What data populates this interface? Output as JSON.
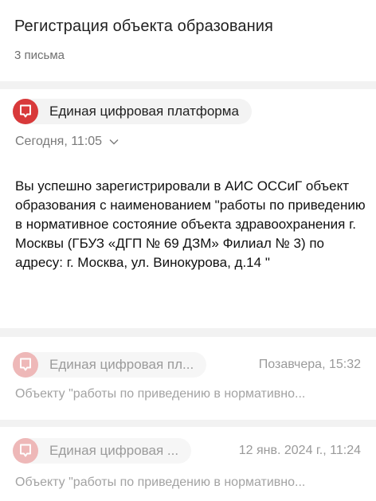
{
  "thread": {
    "title": "Регистрация объекта образования",
    "count": "3 письма"
  },
  "messages": [
    {
      "sender": "Единая цифровая платформа",
      "date": "Сегодня, 11:05",
      "body": "Вы успешно зарегистрировали в АИС ОССиГ объект образования с наименованием \"работы по приведению в нормативное состояние объекта здравоохранения г. Москвы (ГБУЗ «ДГП № 69 ДЗМ» Филиал № 3) по адресу: г. Москва, ул. Винокурова, д.14 \""
    },
    {
      "sender": "Единая цифровая пл...",
      "date": "Позавчера, 15:32",
      "preview": "Объекту \"работы по приведению в нормативно..."
    },
    {
      "sender": "Единая цифровая ...",
      "date": "12 янв. 2024 г., 11:24",
      "preview": "Объекту \"работы по приведению в нормативно..."
    }
  ],
  "colors": {
    "accent": "#d8393a",
    "accent_faded": "#eeb8b8",
    "background": "#f2f2f2"
  }
}
